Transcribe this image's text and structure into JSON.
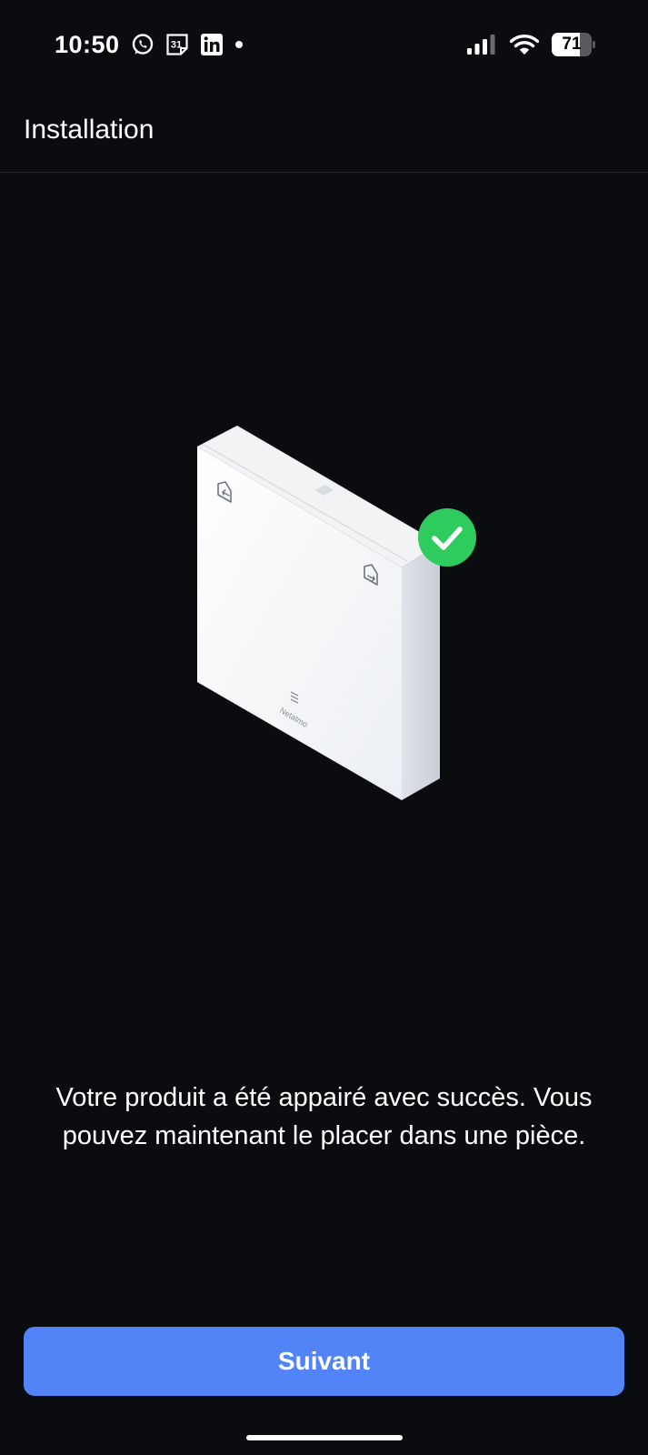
{
  "status_bar": {
    "time": "10:50",
    "calendar_day": "31",
    "battery_level": "71",
    "battery_percent": 71,
    "left_icons": [
      "whatsapp-icon",
      "calendar-icon",
      "linkedin-icon",
      "notification-dot-icon"
    ],
    "right_icons": [
      "cellular-signal-icon",
      "wifi-icon",
      "battery-icon"
    ]
  },
  "header": {
    "title": "Installation"
  },
  "illustration": {
    "device_brand": "Netatmo",
    "badge_icon": "checkmark-icon",
    "badge_color": "#2ecc5e"
  },
  "main": {
    "message": "Votre produit a été appairé avec succès. Vous pouvez maintenant le placer dans une pièce."
  },
  "footer": {
    "next_label": "Suivant",
    "button_color": "#5283f7"
  },
  "colors": {
    "background": "#0b0c10",
    "accent": "#5283f7",
    "success": "#2ecc5e"
  }
}
